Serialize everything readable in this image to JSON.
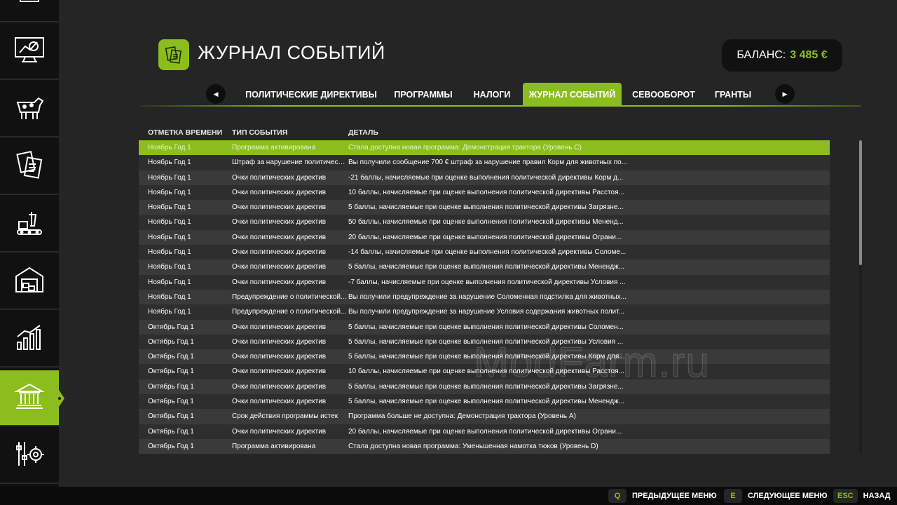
{
  "sidebar": {
    "items": [
      {
        "icon": "money-icon",
        "active": false
      },
      {
        "icon": "monitor-chart-icon",
        "active": false
      },
      {
        "icon": "cow-icon",
        "active": false
      },
      {
        "icon": "contracts-icon",
        "active": false
      },
      {
        "icon": "production-icon",
        "active": false
      },
      {
        "icon": "warehouse-icon",
        "active": false
      },
      {
        "icon": "statistics-icon",
        "active": false
      },
      {
        "icon": "government-building-icon",
        "active": true
      },
      {
        "icon": "settings-icon",
        "active": false
      }
    ]
  },
  "header": {
    "title": "ЖУРНАЛ СОБЫТИЙ",
    "balance_label": "БАЛАНС:",
    "balance_value": "3 485 €"
  },
  "tabs": [
    {
      "label": "ПОЛИТИЧЕСКИЕ ДИРЕКТИВЫ",
      "active": false
    },
    {
      "label": "ПРОГРАММЫ",
      "active": false
    },
    {
      "label": "НАЛОГИ",
      "active": false
    },
    {
      "label": "ЖУРНАЛ СОБЫТИЙ",
      "active": true
    },
    {
      "label": "СЕВООБОРОТ",
      "active": false
    },
    {
      "label": "ГРАНТЫ",
      "active": false
    }
  ],
  "table": {
    "columns": [
      "ОТМЕТКА ВРЕМЕНИ",
      "ТИП СОБЫТИЯ",
      "ДЕТАЛЬ"
    ],
    "rows": [
      [
        "Ноябрь Год 1",
        "Программа активирована",
        "Стала доступна новая программа: Демонстрация трактора (Уровень С)"
      ],
      [
        "Ноябрь Год 1",
        "Штраф за нарушение политическ...",
        "Вы получили сообщение 700 € штраф за нарушение правил Корм для животных по..."
      ],
      [
        "Ноябрь Год 1",
        "Очки политических директив",
        "-21 баллы, начисляемые при оценке выполнения политической директивы Корм д..."
      ],
      [
        "Ноябрь Год 1",
        "Очки политических директив",
        "10 баллы, начисляемые при оценке выполнения политической директивы Расстоя..."
      ],
      [
        "Ноябрь Год 1",
        "Очки политических директив",
        "5 баллы, начисляемые при оценке выполнения политической директивы Загрязне..."
      ],
      [
        "Ноябрь Год 1",
        "Очки политических директив",
        "50 баллы, начисляемые при оценке выполнения политической директивы Мененд..."
      ],
      [
        "Ноябрь Год 1",
        "Очки политических директив",
        "20 баллы, начисляемые при оценке выполнения политической директивы Ограни..."
      ],
      [
        "Ноябрь Год 1",
        "Очки политических директив",
        "-14 баллы, начисляемые при оценке выполнения политической директивы Соломе..."
      ],
      [
        "Ноябрь Год 1",
        "Очки политических директив",
        "5 баллы, начисляемые при оценке выполнения политической директивы Менендж..."
      ],
      [
        "Ноябрь Год 1",
        "Очки политических директив",
        "-7 баллы, начисляемые при оценке выполнения политической директивы Условия ..."
      ],
      [
        "Ноябрь Год 1",
        "Предупреждение о политической...",
        "Вы получили предупреждение за нарушение Соломенная подстилка для животных..."
      ],
      [
        "Ноябрь Год 1",
        "Предупреждение о политической...",
        "Вы получили предупреждение за нарушение Условия содержания животных полит..."
      ],
      [
        "Октябрь Год 1",
        "Очки политических директив",
        "5 баллы, начисляемые при оценке выполнения политической директивы Соломен..."
      ],
      [
        "Октябрь Год 1",
        "Очки политических директив",
        "5 баллы, начисляемые при оценке выполнения политической директивы Условия ..."
      ],
      [
        "Октябрь Год 1",
        "Очки политических директив",
        "5 баллы, начисляемые при оценке выполнения политической директивы Корм для..."
      ],
      [
        "Октябрь Год 1",
        "Очки политических директив",
        "10 баллы, начисляемые при оценке выполнения политической директивы Расстоя..."
      ],
      [
        "Октябрь Год 1",
        "Очки политических директив",
        "5 баллы, начисляемые при оценке выполнения политической директивы Загрязне..."
      ],
      [
        "Октябрь Год 1",
        "Очки политических директив",
        "5 баллы, начисляемые при оценке выполнения политической директивы Менендж..."
      ],
      [
        "Октябрь Год 1",
        "Срок действия программы истек",
        "Программа больше не доступна: Демонстрация трактора (Уровень А)"
      ],
      [
        "Октябрь Год 1",
        "Очки политических директив",
        "20 баллы, начисляемые при оценке выполнения политической директивы Ограни..."
      ],
      [
        "Октябрь Год 1",
        "Программа активирована",
        "Стала доступна новая программа: Уменьшенная намотка тюков (Уровень D)"
      ]
    ]
  },
  "watermark": "ModFarm.ru",
  "footer": {
    "hints": [
      {
        "key": "Q",
        "label": "ПРЕДЫДУЩЕЕ МЕНЮ"
      },
      {
        "key": "E",
        "label": "СЛЕДУЮЩЕЕ МЕНЮ"
      },
      {
        "key": "ESC",
        "label": "НАЗАД"
      }
    ]
  },
  "colors": {
    "accent": "#8cbd1e",
    "background": "#252525",
    "sidebar": "#111111",
    "row_dark": "#2e2e2e",
    "row_light": "#3a3a3a"
  }
}
